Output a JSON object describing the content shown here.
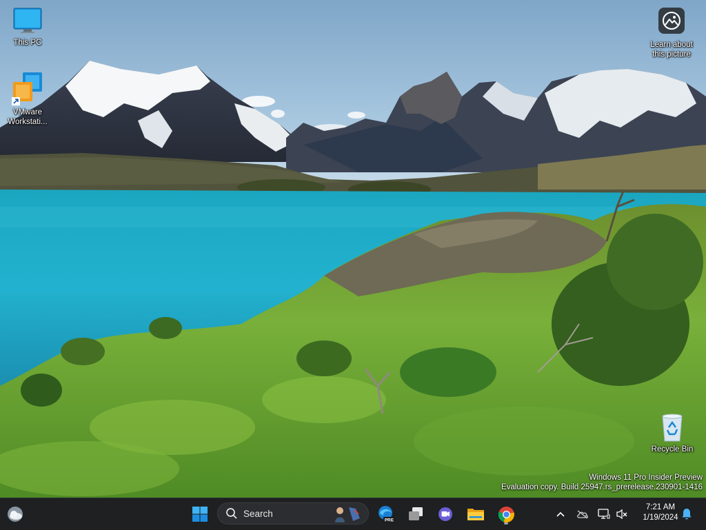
{
  "desktop": {
    "icons": [
      {
        "label": "This PC"
      },
      {
        "label": "VMware Workstati..."
      },
      {
        "label": "Learn about this picture"
      },
      {
        "label": "Recycle Bin"
      }
    ]
  },
  "watermark": {
    "line1": "Windows 11 Pro Insider Preview",
    "line2": "Evaluation copy. Build 25947.rs_prerelease.230901-1416"
  },
  "taskbar": {
    "search_placeholder": "Search",
    "apps": [
      {
        "name": "start-icon"
      },
      {
        "name": "search-icon"
      },
      {
        "name": "edge-preview-icon",
        "badge": "PRE"
      },
      {
        "name": "task-view-icon"
      },
      {
        "name": "teams-chat-icon"
      },
      {
        "name": "file-explorer-icon"
      },
      {
        "name": "chrome-icon"
      }
    ],
    "tray": {
      "icons": [
        "chevron-up-icon",
        "onedrive-icon",
        "network-icon",
        "speaker-muted-icon",
        "notification-bell-icon"
      ],
      "time": "7:21 AM",
      "date": "1/19/2024"
    }
  },
  "colors": {
    "taskbar_bg": "#1e2022",
    "accent": "#0078d4"
  }
}
